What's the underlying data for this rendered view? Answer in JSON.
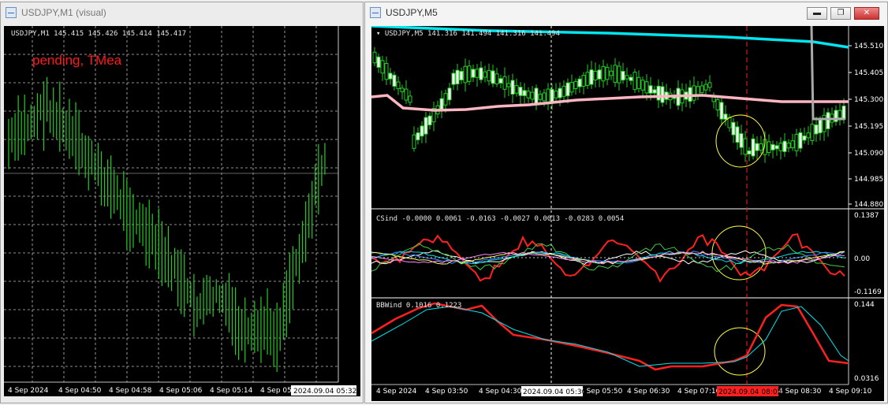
{
  "left_window": {
    "title": "USDJPY,M1 (visual)",
    "ohlc": "USDJPY,M1  145.415 145.426 145.414 145.417",
    "overlay_text": "pending, TMea",
    "time_labels": [
      "4 Sep 2024",
      "4 Sep 04:50",
      "4 Sep 04:58",
      "4 Sep 05:06",
      "4 Sep 05:14",
      "4 Sep 05:"
    ],
    "time_highlight": "2024.09.04 05:32"
  },
  "right_window": {
    "title": "USDJPY,M5",
    "ohlc": "USDJPY,M5  141.316 141.494 141.316 141.494",
    "price_labels": [
      "145.510",
      "145.405",
      "145.300",
      "145.195",
      "145.090",
      "144.985",
      "144.880"
    ],
    "csind": {
      "label": "CSind -0.0000 0.0061 -0.0163 -0.0027 0.0013 -0.0283 0.0054",
      "scale": [
        "0.1387",
        "0.00",
        "-0.1169"
      ]
    },
    "bbwind": {
      "label": "BBWind 0.1016 0.1223",
      "scale": [
        "0.144",
        "0.0316"
      ]
    },
    "time_labels": [
      "4 Sep 2024",
      "4 Sep 03:50",
      "4 Sep 04:30",
      "4 Sep 05:50",
      "4 Sep 06:30",
      "4 Sep 07:10",
      "4 Sep 08:30",
      "4 Sep 09:10"
    ],
    "time_highlight_white": "2024.09.04 05:30",
    "time_highlight_red": "2024.09.04 08:05",
    "buttons": {
      "minimize": "▬",
      "restore": "❐",
      "close": "✕"
    }
  },
  "colors": {
    "candle": "#22cc22",
    "bull_body": "#ffffff",
    "cyan": "#00e5ee",
    "pink": "#ffb6c1",
    "red": "#ff2020",
    "yellow": "#ffff40"
  }
}
